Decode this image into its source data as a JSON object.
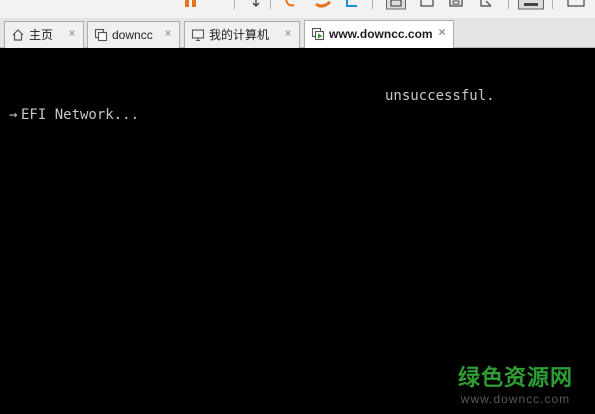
{
  "window": {
    "tabs": [
      {
        "label": "主页",
        "icon": "home-icon",
        "active": false
      },
      {
        "label": "downcc",
        "icon": "vm-clone-icon",
        "active": false
      },
      {
        "label": "我的计算机",
        "icon": "monitor-icon",
        "active": false
      },
      {
        "label": "www.downcc.com",
        "icon": "vm-running-icon",
        "active": true
      }
    ],
    "close_glyph": "×"
  },
  "console": {
    "line1": "unsuccessful.",
    "line2_arrow": "→",
    "line2_text": "EFI Network..."
  },
  "watermark": {
    "title": "绿色资源网",
    "url": "www.downcc.com"
  },
  "colors": {
    "console_bg": "#000000",
    "console_text": "#c8c8c8",
    "watermark_green": "#2e9e34",
    "toolbar_orange": "#e8731e",
    "toolbar_blue": "#1f8fd6"
  },
  "toolbar": {
    "icons": [
      "pause-icon",
      "down-arrow-icon",
      "snapshot-icon",
      "revert-icon",
      "manage-snapshots-icon",
      "view-icon",
      "fullscreen-icon",
      "unity-icon",
      "stretch-icon",
      "console-view-icon"
    ]
  }
}
